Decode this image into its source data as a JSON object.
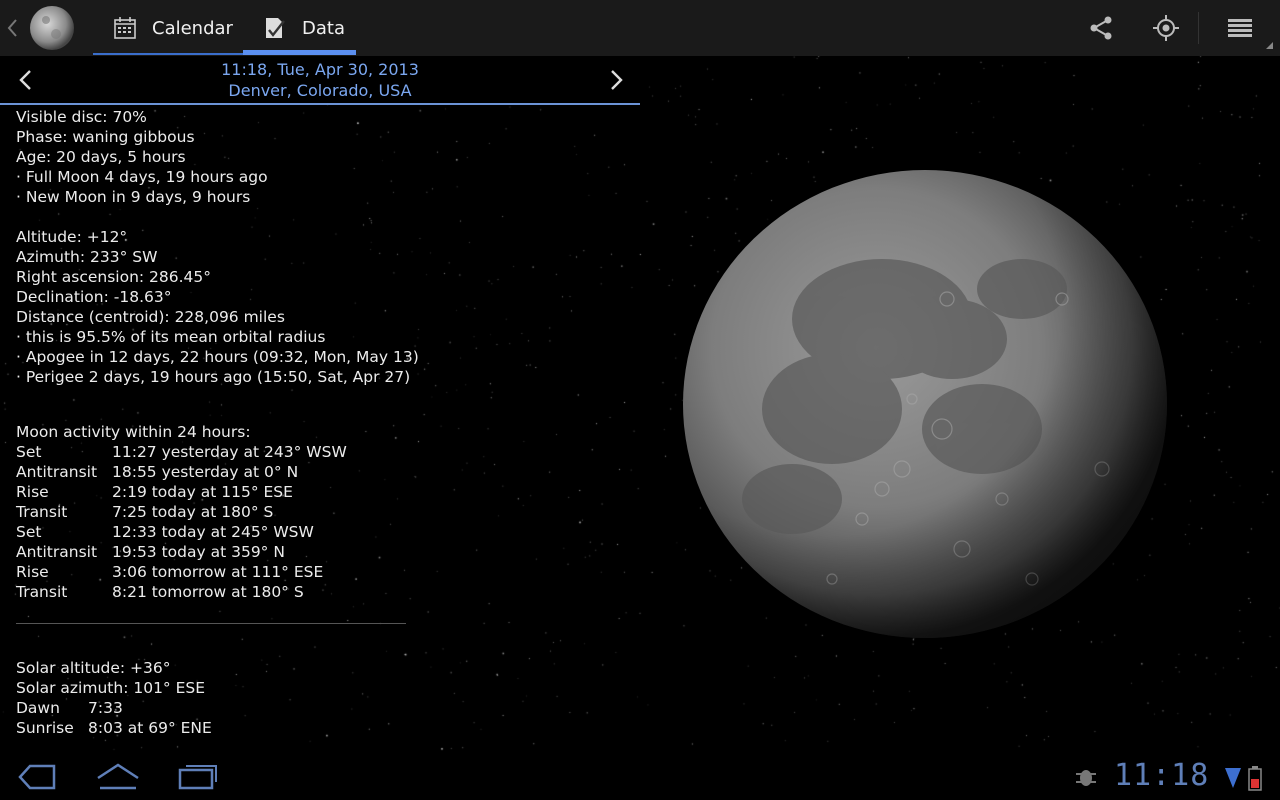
{
  "app": {
    "tabs": [
      {
        "label": "Calendar",
        "icon": "calendar-icon"
      },
      {
        "label": "Data",
        "icon": "data-check-icon",
        "selected": true
      }
    ],
    "accent_color": "#5b8ff0",
    "actions": [
      "share-icon",
      "locate-icon",
      "menu-icon"
    ]
  },
  "header": {
    "datetime": "11:18, Tue, Apr 30, 2013",
    "location": "Denver, Colorado, USA",
    "date_color": "#7ba7f0"
  },
  "moon_info": {
    "visible_disc": "Visible disc: 70%",
    "phase": "Phase: waning gibbous",
    "age": "Age: 20 days, 5 hours",
    "full_moon": "· Full Moon 4 days, 19 hours ago",
    "new_moon": "· New Moon in 9 days, 9 hours",
    "altitude": "Altitude: +12°",
    "azimuth": "Azimuth: 233° SW",
    "right_ascension": "Right ascension: 286.45°",
    "declination": "Declination: -18.63°",
    "distance": "Distance (centroid): 228,096 miles",
    "orbital": "· this is 95.5% of its mean orbital radius",
    "apogee": "· Apogee in 12 days, 22 hours (09:32, Mon, May 13)",
    "perigee": "· Perigee 2 days, 19 hours ago (15:50, Sat, Apr 27)"
  },
  "activity": {
    "title": "Moon activity within 24 hours:",
    "events": [
      {
        "event": "Set",
        "detail": "11:27 yesterday at 243° WSW"
      },
      {
        "event": "Antitransit",
        "detail": "18:55 yesterday at 0° N"
      },
      {
        "event": "Rise",
        "detail": "2:19 today at 115° ESE"
      },
      {
        "event": "Transit",
        "detail": "7:25 today at 180° S"
      },
      {
        "event": "Set",
        "detail": "12:33 today at 245° WSW"
      },
      {
        "event": "Antitransit",
        "detail": "19:53 today at 359° N"
      },
      {
        "event": "Rise",
        "detail": "3:06 tomorrow at 111° ESE"
      },
      {
        "event": "Transit",
        "detail": "8:21 tomorrow at 180° S"
      }
    ]
  },
  "solar": {
    "altitude": "Solar altitude: +36°",
    "azimuth": "Solar azimuth: 101° ESE",
    "events": [
      {
        "event": "Dawn",
        "detail": "7:33"
      },
      {
        "event": "Sunrise",
        "detail": "8:03 at 69° ENE"
      }
    ]
  },
  "system": {
    "clock": "11:18",
    "buttons": [
      "back-icon",
      "home-icon",
      "recents-icon"
    ],
    "status_icons": [
      "debug-icon",
      "signal-icon",
      "battery-icon"
    ]
  }
}
